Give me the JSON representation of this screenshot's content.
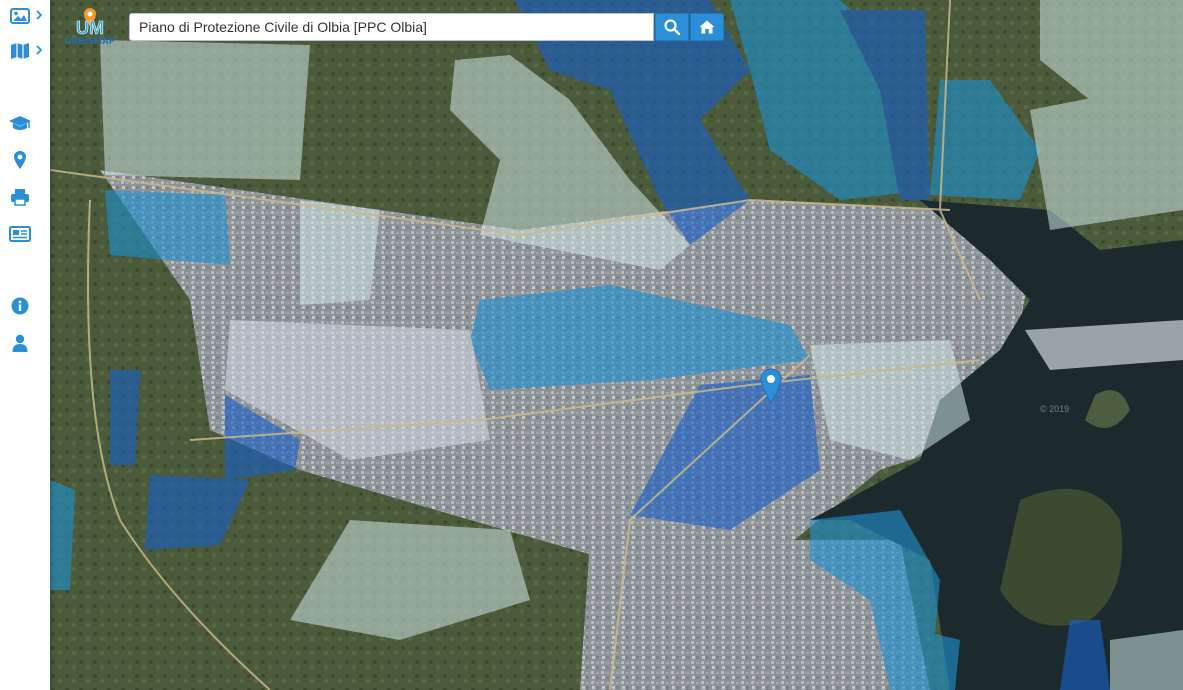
{
  "app": {
    "name_line1": "UM",
    "name_line2": "URBISMAP"
  },
  "search": {
    "value": "Piano di Protezione Civile di Olbia [PPC Olbia]",
    "placeholder": ""
  },
  "colors": {
    "accent": "#2b8fd8",
    "sidebar_icon": "#2b8fd8"
  },
  "sidebar": {
    "items": [
      {
        "icon": "image-icon",
        "has_caret": true
      },
      {
        "icon": "map-icon",
        "has_caret": true
      },
      {
        "icon": "graduation-cap-icon",
        "has_caret": false
      },
      {
        "icon": "map-marker-icon",
        "has_caret": false
      },
      {
        "icon": "print-icon",
        "has_caret": false
      },
      {
        "icon": "newspaper-icon",
        "has_caret": false
      },
      {
        "icon": "info-icon",
        "has_caret": false
      },
      {
        "icon": "user-icon",
        "has_caret": false
      }
    ]
  },
  "map": {
    "watermark": "© 2019"
  }
}
